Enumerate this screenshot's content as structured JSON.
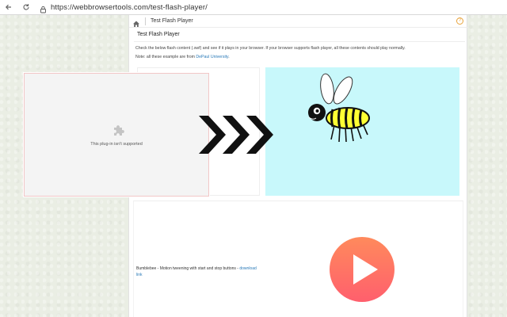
{
  "browser": {
    "url": "https://webbrowsertools.com/test-flash-player/",
    "back_icon": "back-arrow-icon",
    "reload_icon": "reload-icon",
    "lock_icon": "lock-icon"
  },
  "page": {
    "breadcrumb": "Test Flash Player",
    "title": "Test Flash Player",
    "description": "Check the below flash content (.swf) and see if it plays in your browser. If your browser supports flash player, all these contents should play normally.",
    "note_prefix": "Note: all these example are from ",
    "note_link": "DePaul University",
    "note_suffix": ".",
    "plugin_message": "This plug-in isn't supported",
    "caption": "Bumblebee - Motion tweening with start and stop buttons - ",
    "caption_link": "download link"
  },
  "colors": {
    "animation_bg": "#c8f8fb",
    "link": "#2a7ab8",
    "play_gradient_top": "#ff8a5c",
    "play_gradient_bottom": "#ff5f6d",
    "bee_yellow": "#ffff33"
  }
}
